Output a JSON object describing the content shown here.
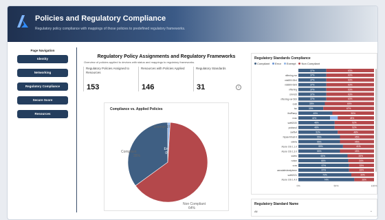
{
  "header": {
    "title": "Policies and Regulatory Compliance",
    "subtitle": "Regulatory policy compliance with mappings of those policies to predefined regulatory frameworks."
  },
  "sidebar": {
    "heading": "Page Navigation",
    "items": [
      {
        "label": "Identity"
      },
      {
        "label": "Networking"
      },
      {
        "label": "Regulatory Compliance"
      },
      {
        "label": "Secure Score"
      },
      {
        "label": "Resources"
      }
    ]
  },
  "kpis": {
    "title": "Regulatory Policy Assignments and Regulatory Frameworks",
    "subtitle": "Overview of policies applied to devices with status and mappings to regulatory frameworks.",
    "items": [
      {
        "label": "Regulatory Policies Assigned to Resources",
        "value": "153"
      },
      {
        "label": "Resources with Policies Applied",
        "value": "146"
      },
      {
        "label": "Regulatory Standards",
        "value": "31"
      }
    ]
  },
  "colors": {
    "compliant": "#3f5f83",
    "error": "#6b95d6",
    "exempt": "#8fb4e8",
    "non_compliant": "#b4484b"
  },
  "chart_data": [
    {
      "type": "pie",
      "title": "Compliance vs. Applied Policies",
      "slices": [
        {
          "name": "Compliant",
          "value": 35,
          "label": "35%"
        },
        {
          "name": "Exempt",
          "value": 1,
          "label": "1%"
        },
        {
          "name": "Error",
          "value": 0,
          "label": "0%"
        },
        {
          "name": "Non Compliant",
          "value": 64,
          "label": "64%"
        }
      ]
    },
    {
      "type": "bar",
      "title": "Regulatory Standards Compliance",
      "legend": [
        "Compliant",
        "Error",
        "Exempt",
        "Non Compliant"
      ],
      "xticks": [
        "0%",
        "50%",
        "100%"
      ],
      "categories": [
        "",
        "nfferring-rwr",
        "nist800-53r4",
        "nist800-53r5",
        "nfferring",
        "cmmcl3",
        "nfferring-rwr-500",
        "cuisl",
        "iso",
        "ifedRamp",
        "ncsc",
        "swift2020",
        "pcidssv4",
        "swiftv4",
        "hipaa-hitrust-9",
        "sdvrta",
        "Azure CIS 1.1.0",
        "Azure CIS 1.3.0",
        "sdvtrs",
        "nzism",
        "cccs",
        "canadafederalpbmm",
        "swift2021",
        "Azure CIS 1.4.0"
      ],
      "series": [
        {
          "name": "Compliant",
          "values": [
            37,
            37,
            37,
            37,
            37,
            37,
            37,
            35,
            33,
            45,
            42,
            48,
            48,
            52,
            55,
            55,
            59,
            55,
            65,
            66,
            67,
            67,
            70,
            74
          ]
        },
        {
          "name": "Error",
          "values": [
            0,
            0,
            0,
            0,
            0,
            0,
            0,
            0,
            0,
            0,
            0,
            0,
            0,
            0,
            0,
            0,
            0,
            0,
            0,
            0,
            0,
            0,
            0,
            0
          ]
        },
        {
          "name": "Exempt",
          "values": [
            0,
            0,
            0,
            0,
            0,
            0,
            0,
            0,
            0,
            0,
            10,
            0,
            0,
            0,
            0,
            0,
            0,
            0,
            0,
            0,
            0,
            0,
            0,
            0
          ]
        },
        {
          "name": "Non Compliant",
          "values": [
            63,
            63,
            63,
            63,
            63,
            63,
            63,
            65,
            67,
            55,
            48,
            52,
            52,
            48,
            45,
            45,
            41,
            45,
            35,
            34,
            33,
            33,
            30,
            26
          ]
        }
      ],
      "data_labels": [
        [
          "37%",
          "63%"
        ],
        [
          "37%",
          "63%"
        ],
        [
          "37%",
          "63%"
        ],
        [
          "37%",
          "63%"
        ],
        [
          "37%",
          "63%"
        ],
        [
          "37%",
          "63%"
        ],
        [
          "37%",
          "63%"
        ],
        [
          "35%",
          "65%"
        ],
        [
          "33%",
          "67%"
        ],
        [
          "45%",
          "55%"
        ],
        [
          "42%",
          "48%"
        ],
        [
          "48%",
          "52%"
        ],
        [
          "48%",
          "52%"
        ],
        [
          "52%",
          "48%"
        ],
        [
          "55%",
          "45%"
        ],
        [
          "55%",
          "45%"
        ],
        [
          "59%",
          "41%"
        ],
        [
          "55%",
          "45%"
        ],
        [
          "65%",
          "35%"
        ],
        [
          "66%",
          "34%"
        ],
        [
          "67%",
          "33%"
        ],
        [
          "67%",
          "33%"
        ],
        [
          "70%",
          "30%"
        ],
        [
          "74%",
          "26%"
        ]
      ]
    }
  ],
  "slicer": {
    "title": "Regulatory Standard Name",
    "value": "All"
  }
}
